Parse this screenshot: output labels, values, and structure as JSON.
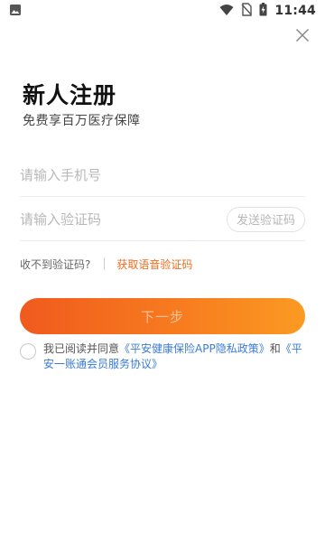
{
  "status_bar": {
    "time": "11:44",
    "icons": [
      "image-icon",
      "wifi-icon",
      "no-sim-icon",
      "battery-charging-icon"
    ]
  },
  "header": {
    "close_icon": "close-icon",
    "title": "新人注册",
    "subtitle": "免费享百万医疗保障"
  },
  "form": {
    "phone": {
      "value": "",
      "placeholder": "请输入手机号"
    },
    "code": {
      "value": "",
      "placeholder": "请输入验证码"
    },
    "send_code_label": "发送验证码"
  },
  "help": {
    "not_received": "收不到验证码?",
    "voice_code_link": "获取语音验证码"
  },
  "next_button": "下一步",
  "agreement": {
    "checked": false,
    "prefix": "我已阅读并同意",
    "policy_link": "《平安健康保险APP隐私政策》",
    "conjunction": "和",
    "service_link": "《平安一账通会员服务协议》"
  },
  "colors": {
    "accent_orange": "#f26b1d",
    "button_gradient_start": "#f05a1e",
    "button_gradient_end": "#fb9a22",
    "link_blue": "#3a7bd5"
  }
}
